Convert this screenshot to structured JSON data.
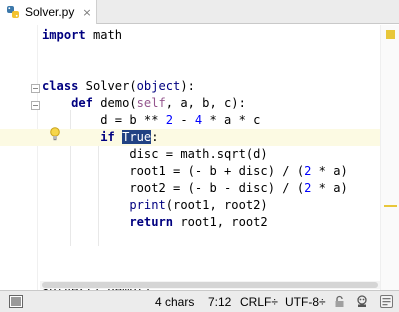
{
  "tab": {
    "filename": "Solver.py",
    "close_glyph": "×"
  },
  "code_lines": [
    {
      "segments": [
        {
          "t": "import",
          "c": "kw"
        },
        {
          "t": " math"
        }
      ]
    },
    {
      "segments": []
    },
    {
      "segments": []
    },
    {
      "segments": [
        {
          "t": "class",
          "c": "kw"
        },
        {
          "t": " Solver("
        },
        {
          "t": "object",
          "c": "builtin"
        },
        {
          "t": "):"
        }
      ]
    },
    {
      "segments": [
        {
          "t": "    "
        },
        {
          "t": "def",
          "c": "kw"
        },
        {
          "t": " demo("
        },
        {
          "t": "self",
          "c": "selfp"
        },
        {
          "t": ", a, b, c):"
        }
      ]
    },
    {
      "segments": [
        {
          "t": "        d = b ** "
        },
        {
          "t": "2",
          "c": "num"
        },
        {
          "t": " - "
        },
        {
          "t": "4",
          "c": "num"
        },
        {
          "t": " * a * c"
        }
      ]
    },
    {
      "segments": [
        {
          "t": "        "
        },
        {
          "t": "if",
          "c": "kw"
        },
        {
          "t": " "
        },
        {
          "t": "True",
          "c": "sel"
        },
        {
          "t": ":"
        }
      ]
    },
    {
      "segments": [
        {
          "t": "            disc = math.sqrt(d)"
        }
      ]
    },
    {
      "segments": [
        {
          "t": "            root1 = (- b + disc) / ("
        },
        {
          "t": "2",
          "c": "num"
        },
        {
          "t": " * a)"
        }
      ]
    },
    {
      "segments": [
        {
          "t": "            root2 = (- b - disc) / ("
        },
        {
          "t": "2",
          "c": "num"
        },
        {
          "t": " * a)"
        }
      ]
    },
    {
      "segments": [
        {
          "t": "            "
        },
        {
          "t": "print",
          "c": "callfn"
        },
        {
          "t": "(root1, root2)"
        }
      ]
    },
    {
      "segments": [
        {
          "t": "            "
        },
        {
          "t": "return",
          "c": "kw"
        },
        {
          "t": " root1, root2"
        }
      ]
    },
    {
      "segments": []
    },
    {
      "segments": []
    },
    {
      "segments": []
    },
    {
      "segments": [
        {
          "t": "Solver().demo()"
        }
      ]
    }
  ],
  "current_line": 6,
  "status": {
    "selection": "4 chars",
    "position": "7:12",
    "line_separator": "CRLF÷",
    "encoding": "UTF-8÷"
  },
  "colors": {
    "keyword": "#000080",
    "number": "#0000ff",
    "self_param": "#94558d",
    "selection_bg": "#214283",
    "current_line_bg": "#fcfae3",
    "marker": "#e8c73a"
  },
  "icons": [
    "python-file-icon",
    "close-icon",
    "fold-icon",
    "intention-bulb-icon",
    "inspection-ok-icon",
    "toggle-tool-windows-icon",
    "lock-icon",
    "inspector-icon",
    "event-log-icon"
  ]
}
